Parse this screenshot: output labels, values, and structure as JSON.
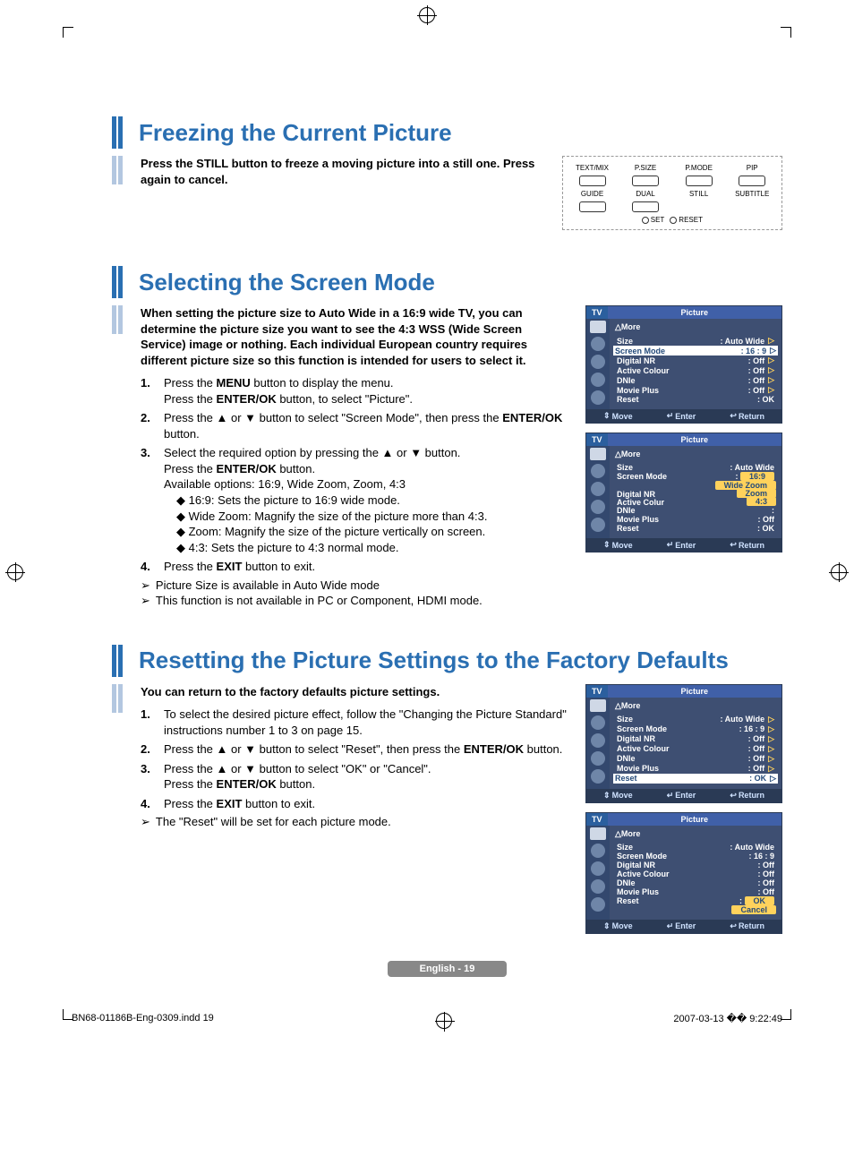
{
  "sections": {
    "freezing": {
      "title": "Freezing the Current Picture",
      "intro": "Press the STILL button to freeze a moving picture into a still one. Press again to cancel."
    },
    "selecting": {
      "title": "Selecting the Screen Mode",
      "intro": "When setting the picture size to Auto Wide in a 16:9 wide TV, you can determine the picture size you want to see the 4:3 WSS (Wide Screen Service) image or nothing. Each individual European country requires different picture size so this function is intended for users to select it.",
      "step1_a": "Press the ",
      "step1_b": "MENU",
      "step1_c": " button to display the menu.",
      "step1_d": "Press the ",
      "step1_e": "ENTER/OK",
      "step1_f": " button, to select \"Picture\".",
      "step2_a": "Press the ▲ or ▼ button to select \"Screen Mode\", then press the ",
      "step2_b": "ENTER/OK",
      "step2_c": " button.",
      "step3_a": "Select the required option by pressing the ▲ or ▼ button.",
      "step3_b": "Press the ",
      "step3_c": "ENTER/OK",
      "step3_d": " button.",
      "step3_opts": "Available options: 16:9, Wide Zoom, Zoom, 4:3",
      "step3_o1": "◆ 16:9: Sets the picture to 16:9 wide mode.",
      "step3_o2": "◆ Wide Zoom: Magnify the size of the picture more than 4:3.",
      "step3_o3": "◆ Zoom: Magnify the size of the picture vertically on screen.",
      "step3_o4": "◆ 4:3: Sets the picture to 4:3 normal mode.",
      "step4_a": "Press the ",
      "step4_b": "EXIT",
      "step4_c": " button to exit.",
      "note1": "Picture Size is available in Auto Wide mode",
      "note2": "This function is not available in PC or Component, HDMI mode."
    },
    "reset": {
      "title": "Resetting the Picture Settings to the Factory Defaults",
      "intro": "You can return to the factory defaults picture settings.",
      "step1": "To select the desired picture effect, follow the \"Changing the Picture Standard\" instructions number 1 to 3 on page 15.",
      "step2_a": "Press the ▲ or ▼ button to select \"Reset\", then press the ",
      "step2_b": "ENTER/OK",
      "step2_c": " button.",
      "step3_a": "Press the ▲ or ▼ button to select \"OK\" or \"Cancel\".",
      "step3_b": "Press the ",
      "step3_c": "ENTER/OK",
      "step3_d": " button.",
      "step4_a": "Press the ",
      "step4_b": "EXIT",
      "step4_c": " button to exit.",
      "note1": "The \"Reset\" will be set for each picture mode."
    }
  },
  "nums": {
    "n1": "1.",
    "n2": "2.",
    "n3": "3.",
    "n4": "4."
  },
  "icons": {
    "note": "➢",
    "up": "▲",
    "down": "▼",
    "diamond": "◆",
    "tri": "△",
    "udarr": "⇕",
    "enter": "↵",
    "return": "↩",
    "play_r": "▷"
  },
  "remote": {
    "r1c1": "TEXT/MIX",
    "r1c2": "P.SIZE",
    "r1c3": "P.MODE",
    "r1c4": "PIP",
    "r2c1": "GUIDE",
    "r2c2": "DUAL",
    "r2c3": "STILL",
    "r2c4": "SUBTITLE",
    "set": "SET",
    "reset": "RESET"
  },
  "osd": {
    "tv": "TV",
    "title": "Picture",
    "more": "More",
    "k_size": "Size",
    "k_screenmode": "Screen Mode",
    "k_digitalnr": "Digital NR",
    "k_activecolour": "Active Colour",
    "k_activecolur": "Active Colur",
    "k_dnie": "DNIe",
    "k_movieplus": "Movie Plus",
    "k_reset": "Reset",
    "v_autowide": ": Auto Wide",
    "v_169": ": 16 : 9",
    "v_off": ": Off",
    "v_ok": ": OK",
    "v_colon": ":",
    "opt_169": "16:9",
    "opt_widezoom": "Wide Zoom",
    "opt_zoom": "Zoom",
    "opt_43": "4:3",
    "opt_ok": "OK",
    "opt_cancel": "Cancel",
    "f_move": "Move",
    "f_enter": "Enter",
    "f_return": "Return"
  },
  "footer": {
    "page": "English - 19",
    "docid": "BN68-01186B-Eng-0309.indd   19",
    "date": "2007-03-13   �� 9:22:49"
  }
}
